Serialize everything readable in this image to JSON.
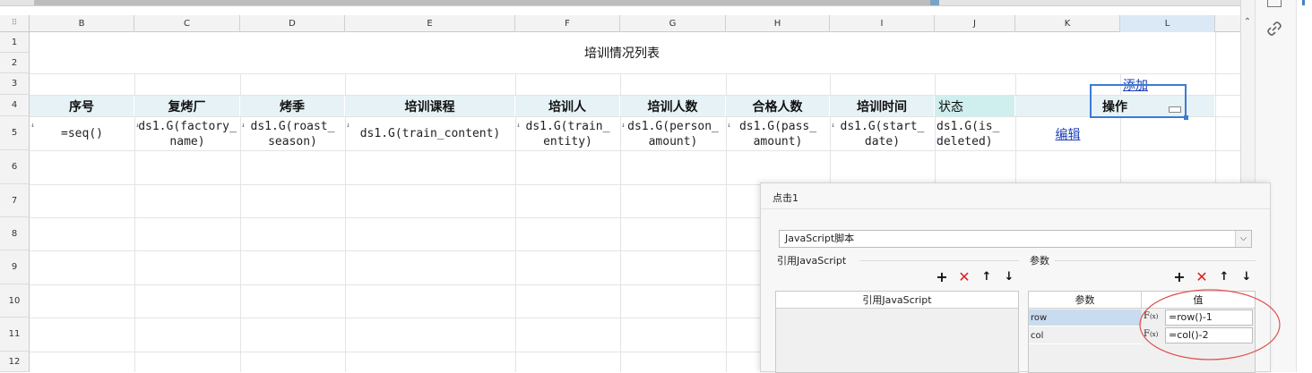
{
  "columns": [
    "B",
    "C",
    "D",
    "E",
    "F",
    "G",
    "H",
    "I",
    "J",
    "K",
    "L"
  ],
  "rows": [
    "1",
    "2",
    "3",
    "4",
    "5",
    "6",
    "7",
    "8",
    "9",
    "10",
    "11",
    "12"
  ],
  "report": {
    "title": "培训情况列表",
    "add_link": "添加",
    "headers": [
      "序号",
      "复烤厂",
      "烤季",
      "培训课程",
      "培训人",
      "培训人数",
      "合格人数",
      "培训时间",
      "状态",
      "操作"
    ],
    "formulas": {
      "b": "=seq()",
      "c1": "ds1.G(factory_",
      "c2": "name)",
      "d1": "ds1.G(roast_",
      "d2": "season)",
      "e": "ds1.G(train_content)",
      "f1": "ds1.G(train_",
      "f2": "entity)",
      "g1": "ds1.G(person_",
      "g2": "amount)",
      "h1": "ds1.G(pass_",
      "h2": "amount)",
      "i1": "ds1.G(start_",
      "i2": "date)",
      "j1": "ds1.G(is_",
      "j2": "deleted)"
    },
    "edit_link": "编辑"
  },
  "dialog": {
    "title": "点击1",
    "type_select": "JavaScript脚本",
    "ref_section": "引用JavaScript",
    "ref_table_header": "引用JavaScript",
    "param_section": "参数",
    "param_table": {
      "col_param": "参数",
      "col_value": "值",
      "rows": [
        {
          "name": "row",
          "value": "=row()-1"
        },
        {
          "name": "col",
          "value": "=col()-2"
        }
      ]
    },
    "fx_label": "F",
    "fx_sub": "(x)"
  },
  "colors": {
    "header_bg": "#e6f2f6",
    "status_header_bg": "#cfeeee",
    "link": "#1a3fb8",
    "selection": "#3a7bd5",
    "delete_icon": "#e02020"
  }
}
